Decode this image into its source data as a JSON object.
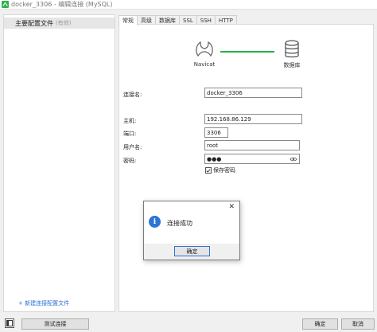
{
  "window": {
    "title": "docker_3306 - 编辑连接 (MySQL)"
  },
  "sidebar": {
    "profile_label": "主要配置文件",
    "profile_note": "(有效)",
    "new_profile_link": "+ 新建连接配置文件"
  },
  "tabs": [
    "常规",
    "高级",
    "数据库",
    "SSL",
    "SSH",
    "HTTP"
  ],
  "active_tab": "常规",
  "diagram": {
    "navicat_label": "Navicat",
    "database_label": "数据库",
    "line_color": "#25b14a"
  },
  "form": {
    "connection_name": {
      "label": "连接名:",
      "value": "docker_3306"
    },
    "host": {
      "label": "主机:",
      "value": "192.168.86.129"
    },
    "port": {
      "label": "端口:",
      "value": "3306"
    },
    "username": {
      "label": "用户名:",
      "value": "root"
    },
    "password": {
      "label": "密码:",
      "value": "●●●"
    },
    "save_password": {
      "label": "保存密码",
      "checked": true
    }
  },
  "dialog": {
    "icon": "info-icon",
    "message": "连接成功",
    "ok_label": "确定",
    "close_glyph": "✕"
  },
  "footer": {
    "test_button": "测试连接",
    "ok_button": "确定",
    "cancel_button": "取消"
  },
  "colors": {
    "accent_blue": "#2d74d6",
    "brand_green": "#2eb24b",
    "link_blue": "#2b6fd6"
  }
}
